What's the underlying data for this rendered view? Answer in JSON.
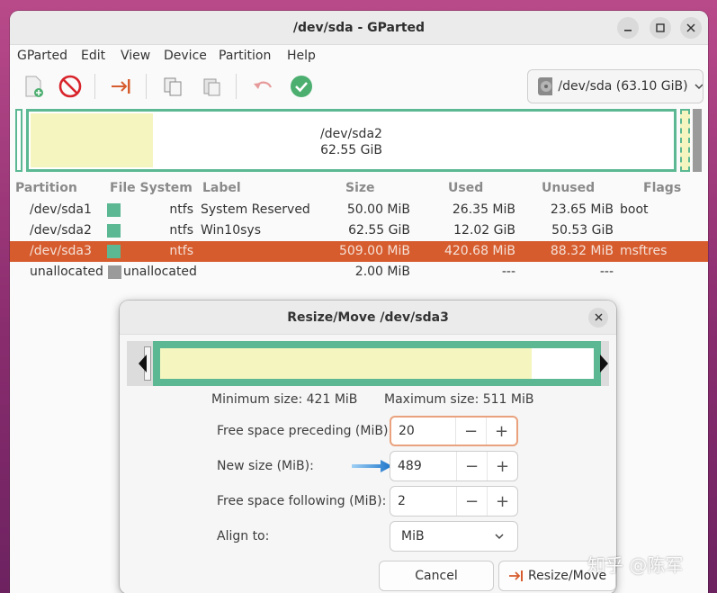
{
  "window": {
    "title": "/dev/sda - GParted"
  },
  "menu": [
    "GParted",
    "Edit",
    "View",
    "Device",
    "Partition",
    "Help"
  ],
  "device_selector": {
    "label": "/dev/sda (63.10 GiB)"
  },
  "disk_map": {
    "name": "/dev/sda2",
    "size": "62.55 GiB"
  },
  "columns": [
    "Partition",
    "File System",
    "Label",
    "Size",
    "Used",
    "Unused",
    "Flags"
  ],
  "partitions": [
    {
      "partition": "/dev/sda1",
      "fs": "ntfs",
      "label": "System Reserved",
      "size": "50.00 MiB",
      "used": "26.35 MiB",
      "unused": "23.65 MiB",
      "flags": "boot",
      "color": "#5bb893",
      "selected": false
    },
    {
      "partition": "/dev/sda2",
      "fs": "ntfs",
      "label": "Win10sys",
      "size": "62.55 GiB",
      "used": "12.02 GiB",
      "unused": "50.53 GiB",
      "flags": "",
      "color": "#5bb893",
      "selected": false
    },
    {
      "partition": "/dev/sda3",
      "fs": "ntfs",
      "label": "",
      "size": "509.00 MiB",
      "used": "420.68 MiB",
      "unused": "88.32 MiB",
      "flags": "msftres",
      "color": "#5bb893",
      "selected": true
    },
    {
      "partition": "unallocated",
      "fs": "unallocated",
      "label": "",
      "size": "2.00 MiB",
      "used": "---",
      "unused": "---",
      "flags": "",
      "color": "#9a9a9a",
      "selected": false
    }
  ],
  "dialog": {
    "title": "Resize/Move /dev/sda3",
    "min_size": "Minimum size: 421 MiB",
    "max_size": "Maximum size: 511 MiB",
    "fields": [
      {
        "label": "Free space preceding (MiB):",
        "value": "20"
      },
      {
        "label": "New size (MiB):",
        "value": "489"
      },
      {
        "label": "Free space following (MiB):",
        "value": "2"
      }
    ],
    "align_label": "Align to:",
    "align_value": "MiB",
    "cancel": "Cancel",
    "resize": "Resize/Move"
  },
  "watermark": "知乎 @陈军",
  "colors": {
    "selection": "#d65c2e",
    "ntfs": "#5bb893",
    "used": "#f5f5c0",
    "accent_green": "#4caf70",
    "stop_red": "#d8232a"
  }
}
